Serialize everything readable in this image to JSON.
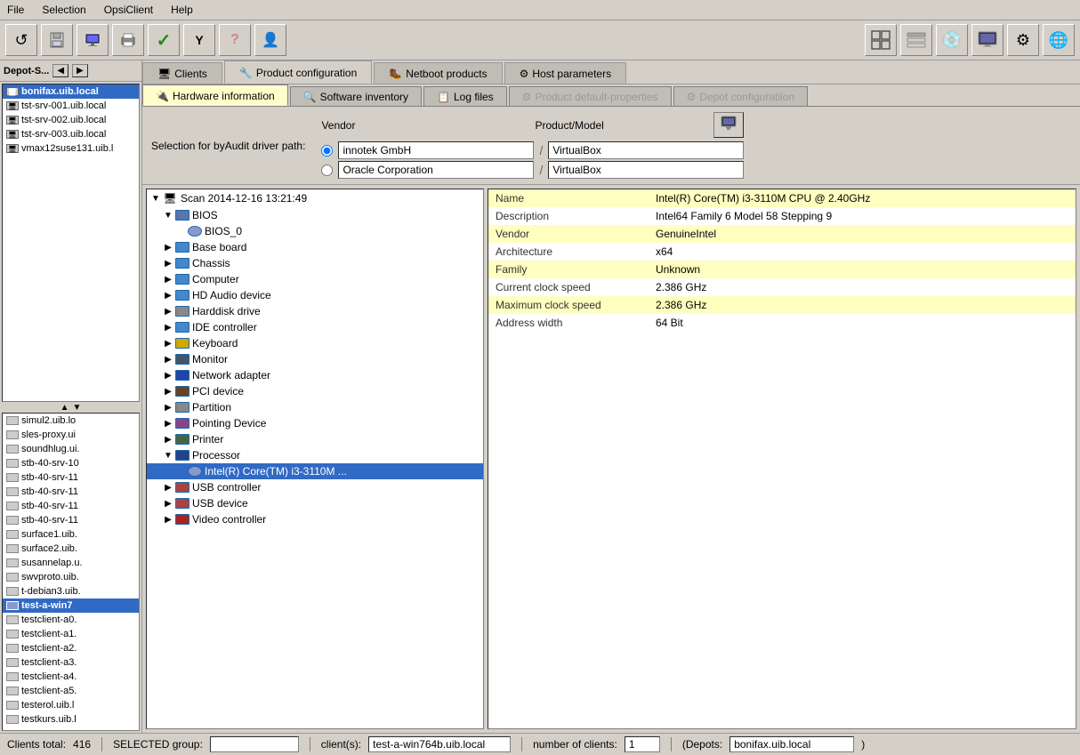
{
  "menubar": {
    "items": [
      "File",
      "Selection",
      "OpsiClient",
      "Help"
    ]
  },
  "toolbar": {
    "buttons": [
      {
        "name": "reload-btn",
        "icon": "↺",
        "label": "Reload"
      },
      {
        "name": "save-all-btn",
        "icon": "💾",
        "label": "Save all"
      },
      {
        "name": "client-btn",
        "icon": "🖥",
        "label": "Client"
      },
      {
        "name": "print-btn",
        "icon": "🖨",
        "label": "Print"
      },
      {
        "name": "check-btn",
        "icon": "✓",
        "label": "Check"
      },
      {
        "name": "filter-btn",
        "icon": "Y",
        "label": "Filter"
      },
      {
        "name": "help2-btn",
        "icon": "?",
        "label": "Help"
      },
      {
        "name": "user-btn",
        "icon": "👤",
        "label": "User"
      }
    ],
    "right_buttons": [
      {
        "name": "grid1-btn",
        "icon": "⊞"
      },
      {
        "name": "grid2-btn",
        "icon": "⊟"
      },
      {
        "name": "cd-btn",
        "icon": "💿"
      },
      {
        "name": "monitor2-btn",
        "icon": "🖥"
      },
      {
        "name": "settings-btn",
        "icon": "⚙"
      },
      {
        "name": "web-btn",
        "icon": "🌐"
      }
    ]
  },
  "sidebar": {
    "title": "Depot-S...",
    "items": [
      {
        "label": "bonifax.uib.local",
        "selected": false,
        "bold": true
      },
      {
        "label": "tst-srv-001.uib.local",
        "selected": false
      },
      {
        "label": "tst-srv-002.uib.local",
        "selected": false
      },
      {
        "label": "tst-srv-003.uib.local",
        "selected": false
      },
      {
        "label": "vmax12suse131.uib.l",
        "selected": false
      }
    ],
    "clients": [
      {
        "label": "simul2.uib.lo",
        "selected": false
      },
      {
        "label": "sles-proxy.ui",
        "selected": false
      },
      {
        "label": "soundhlug.ui.",
        "selected": false
      },
      {
        "label": "stb-40-srv-10",
        "selected": false
      },
      {
        "label": "stb-40-srv-11",
        "selected": false
      },
      {
        "label": "stb-40-srv-11",
        "selected": false
      },
      {
        "label": "stb-40-srv-11",
        "selected": false
      },
      {
        "label": "stb-40-srv-11",
        "selected": false
      },
      {
        "label": "surface1.uib.",
        "selected": false
      },
      {
        "label": "surface2.uib.",
        "selected": false
      },
      {
        "label": "susannelap.u.",
        "selected": false
      },
      {
        "label": "swvproto.uib.",
        "selected": false
      },
      {
        "label": "t-debian3.uib.",
        "selected": false
      },
      {
        "label": "test-a-win7",
        "selected": true
      },
      {
        "label": "testclient-a0.",
        "selected": false
      },
      {
        "label": "testclient-a1.",
        "selected": false
      },
      {
        "label": "testclient-a2.",
        "selected": false
      },
      {
        "label": "testclient-a3.",
        "selected": false
      },
      {
        "label": "testclient-a4.",
        "selected": false
      },
      {
        "label": "testclient-a5.",
        "selected": false
      },
      {
        "label": "testerol.uib.l",
        "selected": false
      },
      {
        "label": "testkurs.uib.l",
        "selected": false
      }
    ]
  },
  "tabs_outer": [
    {
      "label": "Clients",
      "icon": "🖥",
      "active": false
    },
    {
      "label": "Product configuration",
      "icon": "🔧",
      "active": true
    },
    {
      "label": "Netboot products",
      "icon": "🥾",
      "active": false
    },
    {
      "label": "Host parameters",
      "icon": "⚙",
      "active": false
    }
  ],
  "tabs_inner": [
    {
      "label": "Hardware information",
      "icon": "🔌",
      "active": true
    },
    {
      "label": "Software inventory",
      "icon": "🔍",
      "active": false
    },
    {
      "label": "Log files",
      "icon": "📋",
      "active": false
    },
    {
      "label": "Product default-properties",
      "icon": "⚙",
      "active": false,
      "disabled": true
    },
    {
      "label": "Depot configuratiion",
      "icon": "⚙",
      "active": false,
      "disabled": true
    }
  ],
  "filter": {
    "label": "Selection for byAudit driver path:",
    "vendor_label": "Vendor",
    "productmodel_label": "Product/Model",
    "radio1": {
      "vendor": "innotek GmbH",
      "model": "VirtualBox",
      "checked": true
    },
    "radio2": {
      "vendor": "Oracle Corporation",
      "model": "VirtualBox",
      "checked": false
    }
  },
  "tree": {
    "scan_label": "Scan 2014-12-16 13:21:49",
    "items": [
      {
        "label": "BIOS",
        "level": 1,
        "expanded": true,
        "icon": "bios"
      },
      {
        "label": "BIOS_0",
        "level": 2,
        "icon": "bios-item"
      },
      {
        "label": "Base board",
        "level": 1,
        "expanded": false,
        "icon": "board"
      },
      {
        "label": "Chassis",
        "level": 1,
        "expanded": false,
        "icon": "chassis"
      },
      {
        "label": "Computer",
        "level": 1,
        "expanded": false,
        "icon": "computer"
      },
      {
        "label": "HD Audio device",
        "level": 1,
        "expanded": false,
        "icon": "audio"
      },
      {
        "label": "Harddisk drive",
        "level": 1,
        "expanded": false,
        "icon": "disk"
      },
      {
        "label": "IDE controller",
        "level": 1,
        "expanded": false,
        "icon": "ide"
      },
      {
        "label": "Keyboard",
        "level": 1,
        "expanded": false,
        "icon": "keyboard"
      },
      {
        "label": "Monitor",
        "level": 1,
        "expanded": false,
        "icon": "monitor"
      },
      {
        "label": "Network adapter",
        "level": 1,
        "expanded": false,
        "icon": "network"
      },
      {
        "label": "PCI device",
        "level": 1,
        "expanded": false,
        "icon": "pci"
      },
      {
        "label": "Partition",
        "level": 1,
        "expanded": false,
        "icon": "partition"
      },
      {
        "label": "Pointing Device",
        "level": 1,
        "expanded": false,
        "icon": "mouse"
      },
      {
        "label": "Printer",
        "level": 1,
        "expanded": false,
        "icon": "printer"
      },
      {
        "label": "Processor",
        "level": 1,
        "expanded": true,
        "icon": "processor"
      },
      {
        "label": "Intel(R) Core(TM) i3-3110M ...",
        "level": 2,
        "icon": "cpu-item",
        "selected": true
      },
      {
        "label": "USB controller",
        "level": 1,
        "expanded": false,
        "icon": "usb"
      },
      {
        "label": "USB device",
        "level": 1,
        "expanded": false,
        "icon": "usb"
      },
      {
        "label": "Video controller",
        "level": 1,
        "expanded": false,
        "icon": "video"
      }
    ]
  },
  "details": {
    "rows": [
      {
        "key": "Name",
        "value": "Intel(R) Core(TM) i3-3110M CPU @ 2.40GHz"
      },
      {
        "key": "Description",
        "value": "Intel64 Family 6 Model 58 Stepping 9"
      },
      {
        "key": "Vendor",
        "value": "GenuineIntel"
      },
      {
        "key": "Architecture",
        "value": "x64"
      },
      {
        "key": "Family",
        "value": "Unknown"
      },
      {
        "key": "Current clock speed",
        "value": "2.386 GHz"
      },
      {
        "key": "Maximum clock speed",
        "value": "2.386 GHz"
      },
      {
        "key": "Address width",
        "value": "64 Bit"
      }
    ]
  },
  "statusbar": {
    "clients_total_label": "Clients total:",
    "clients_total": "416",
    "selected_group_label": "SELECTED group:",
    "selected_group": "",
    "clients_label": "client(s):",
    "clients_value": "test-a-win764b.uib.local",
    "num_clients_label": "number of clients:",
    "num_clients": "1",
    "depots_label": "(Depots:",
    "depots_value": "bonifax.uib.local",
    "depots_close": ")"
  }
}
